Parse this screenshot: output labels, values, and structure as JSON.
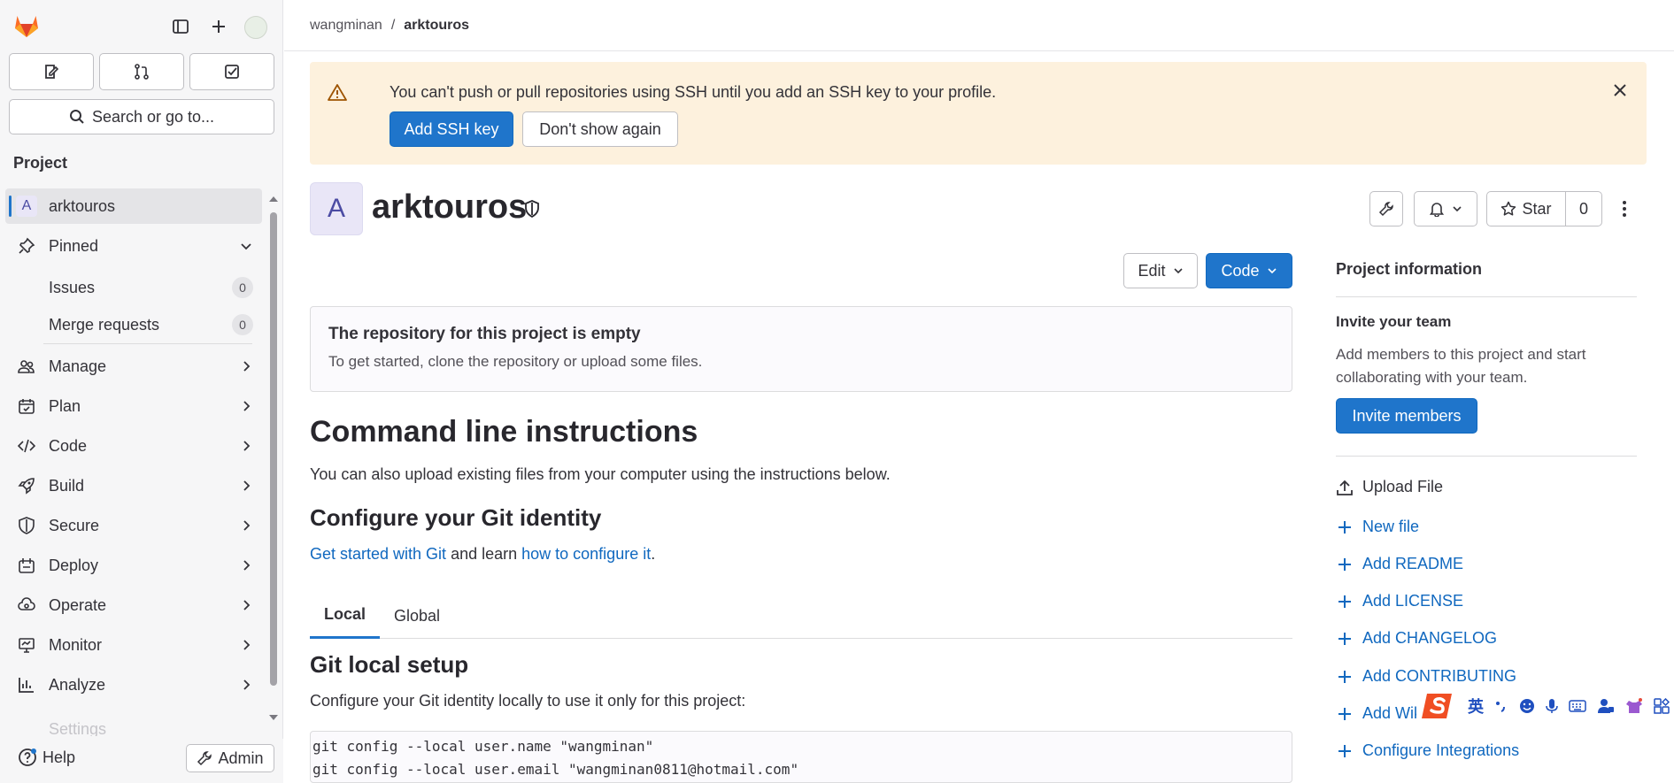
{
  "sidebar": {
    "search_label": "Search or go to...",
    "section_title": "Project",
    "project_item": {
      "avatar_letter": "A",
      "label": "arktouros"
    },
    "pinned": {
      "label": "Pinned"
    },
    "pinned_items": [
      {
        "label": "Issues",
        "count": "0"
      },
      {
        "label": "Merge requests",
        "count": "0"
      }
    ],
    "items": [
      {
        "label": "Manage",
        "icon": "users-icon"
      },
      {
        "label": "Plan",
        "icon": "planning-icon"
      },
      {
        "label": "Code",
        "icon": "code-icon"
      },
      {
        "label": "Build",
        "icon": "rocket-icon"
      },
      {
        "label": "Secure",
        "icon": "shield-icon"
      },
      {
        "label": "Deploy",
        "icon": "deployments-icon"
      },
      {
        "label": "Operate",
        "icon": "cloud-gear-icon"
      },
      {
        "label": "Monitor",
        "icon": "monitor-icon"
      },
      {
        "label": "Analyze",
        "icon": "chart-icon"
      }
    ],
    "faded_item": "Settings",
    "help_label": "Help",
    "admin_label": "Admin"
  },
  "breadcrumb": {
    "owner": "wangminan",
    "separator": "/",
    "project": "arktouros"
  },
  "alert": {
    "message": "You can't push or pull repositories using SSH until you add an SSH key to your profile.",
    "primary_label": "Add SSH key",
    "secondary_label": "Don't show again"
  },
  "project": {
    "avatar_letter": "A",
    "name": "arktouros",
    "star_label": "Star",
    "star_count": "0",
    "edit_label": "Edit",
    "code_label": "Code"
  },
  "empty_repo": {
    "title": "The repository for this project is empty",
    "subtitle": "To get started, clone the repository or upload some files."
  },
  "instructions": {
    "title": "Command line instructions",
    "intro": "You can also upload existing files from your computer using the instructions below.",
    "identity_title": "Configure your Git identity",
    "link1": "Get started with Git",
    "mid_text": " and learn ",
    "link2": "how to configure it",
    "end_text": ".",
    "tabs": [
      "Local",
      "Global"
    ],
    "setup_title": "Git local setup",
    "setup_desc": "Configure your Git identity locally to use it only for this project:",
    "code_lines": [
      "git config --local user.name \"wangminan\"",
      "git config --local user.email \"wangminan0811@hotmail.com\""
    ]
  },
  "project_info": {
    "title": "Project information",
    "invite_title": "Invite your team",
    "invite_desc_1": "Add members to this project and start",
    "invite_desc_2": "collaborating with your team.",
    "invite_button": "Invite members",
    "upload_file": "Upload File",
    "actions": [
      "New file",
      "Add README",
      "Add LICENSE",
      "Add CHANGELOG",
      "Add CONTRIBUTING",
      "Add Wiki",
      "Configure Integrations"
    ]
  },
  "ime_toolbar": {
    "mode_label": "英"
  },
  "colors": {
    "primary": "#1f75cb",
    "link": "#1068bf",
    "alert_bg": "#fdf1dd",
    "sidebar_bg": "#f6f6f7"
  }
}
